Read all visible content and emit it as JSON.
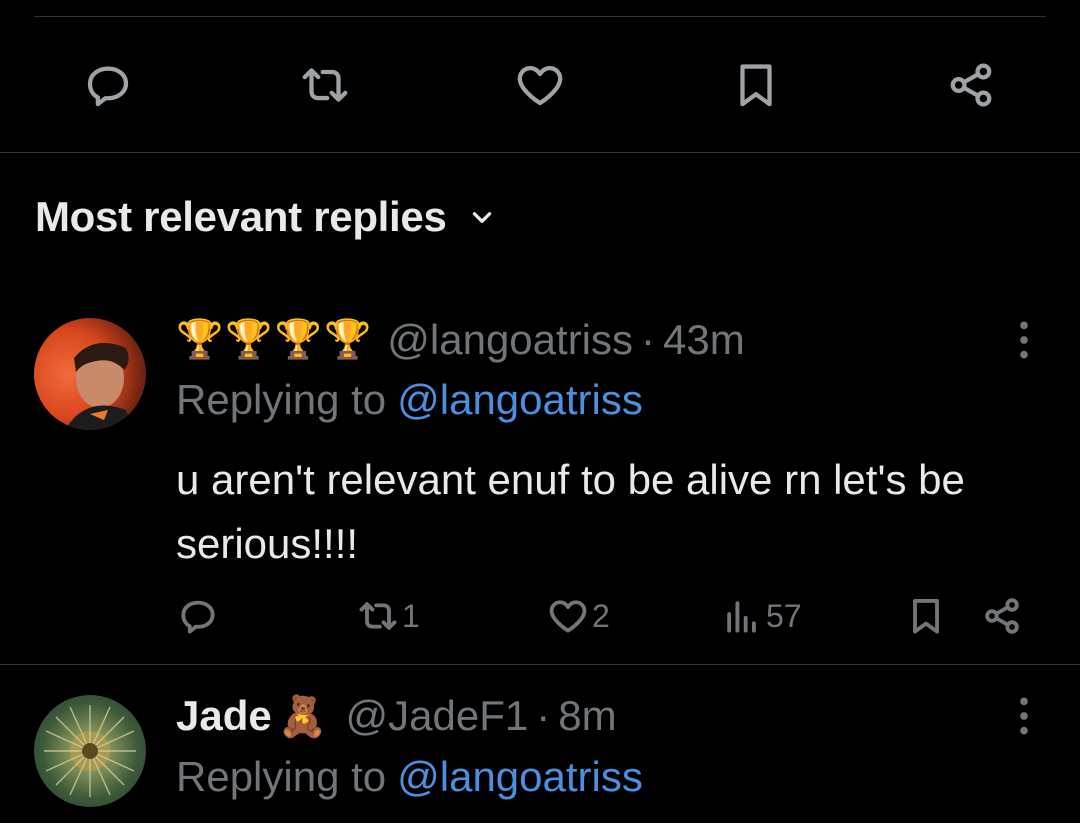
{
  "action_bar": {
    "items": [
      {
        "icon": "reply-icon"
      },
      {
        "icon": "repost-icon"
      },
      {
        "icon": "like-icon"
      },
      {
        "icon": "bookmark-icon"
      },
      {
        "icon": "share-icon"
      }
    ]
  },
  "section": {
    "title": "Most relevant replies"
  },
  "replies": [
    {
      "display_name": "🏆🏆🏆🏆",
      "handle": "@langoatriss",
      "separator": "·",
      "time": "43m",
      "replying_label": "Replying to",
      "replying_to": "@langoatriss",
      "text": "u aren't relevant enuf to be alive rn let's be serious!!!!",
      "stats": {
        "reposts": "1",
        "likes": "2",
        "views": "57"
      }
    },
    {
      "display_name": "Jade",
      "name_emoji": "🧸",
      "handle": "@JadeF1",
      "separator": "·",
      "time": "8m",
      "replying_label": "Replying to",
      "replying_to": "@langoatriss"
    }
  ],
  "colors": {
    "background": "#000000",
    "text": "#e7e9ea",
    "secondary": "#71767b",
    "link": "#4b8fe1",
    "divider": "#2f3336"
  }
}
